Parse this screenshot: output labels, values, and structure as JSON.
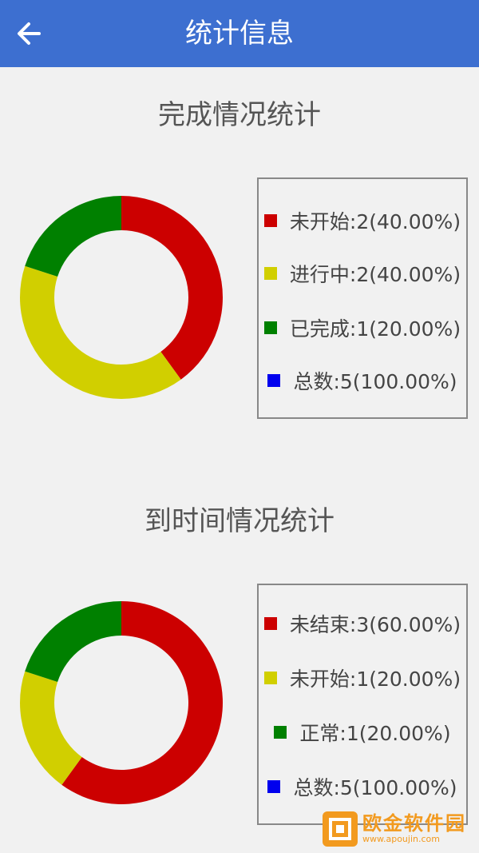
{
  "header": {
    "title": "统计信息",
    "back_icon": "arrow-left-icon"
  },
  "colors": {
    "appbar": "#3d6fd0",
    "red": "#cc0000",
    "yellow": "#d1cf00",
    "green": "#008000",
    "blue": "#0000ee"
  },
  "sections": [
    {
      "title": "完成情况统计",
      "legend": [
        {
          "label": "未开始:2(40.00%)",
          "color": "#cc0000"
        },
        {
          "label": "进行中:2(40.00%)",
          "color": "#d1cf00"
        },
        {
          "label": "已完成:1(20.00%)",
          "color": "#008000"
        },
        {
          "label": "总数:5(100.00%)",
          "color": "#0000ee"
        }
      ]
    },
    {
      "title": "到时间情况统计",
      "legend": [
        {
          "label": "未结束:3(60.00%)",
          "color": "#cc0000"
        },
        {
          "label": "未开始:1(20.00%)",
          "color": "#d1cf00"
        },
        {
          "label": "正常:1(20.00%)",
          "color": "#008000"
        },
        {
          "label": "总数:5(100.00%)",
          "color": "#0000ee"
        }
      ]
    }
  ],
  "chart_data": [
    {
      "type": "pie",
      "title": "完成情况统计",
      "categories": [
        "未开始",
        "进行中",
        "已完成"
      ],
      "values": [
        2,
        2,
        1
      ],
      "colors": [
        "#cc0000",
        "#d1cf00",
        "#008000"
      ]
    },
    {
      "type": "pie",
      "title": "到时间情况统计",
      "categories": [
        "未结束",
        "未开始",
        "正常"
      ],
      "values": [
        3,
        1,
        1
      ],
      "colors": [
        "#cc0000",
        "#d1cf00",
        "#008000"
      ]
    }
  ],
  "watermark": {
    "name": "欧金软件园",
    "url": "www.apoujin.com"
  }
}
